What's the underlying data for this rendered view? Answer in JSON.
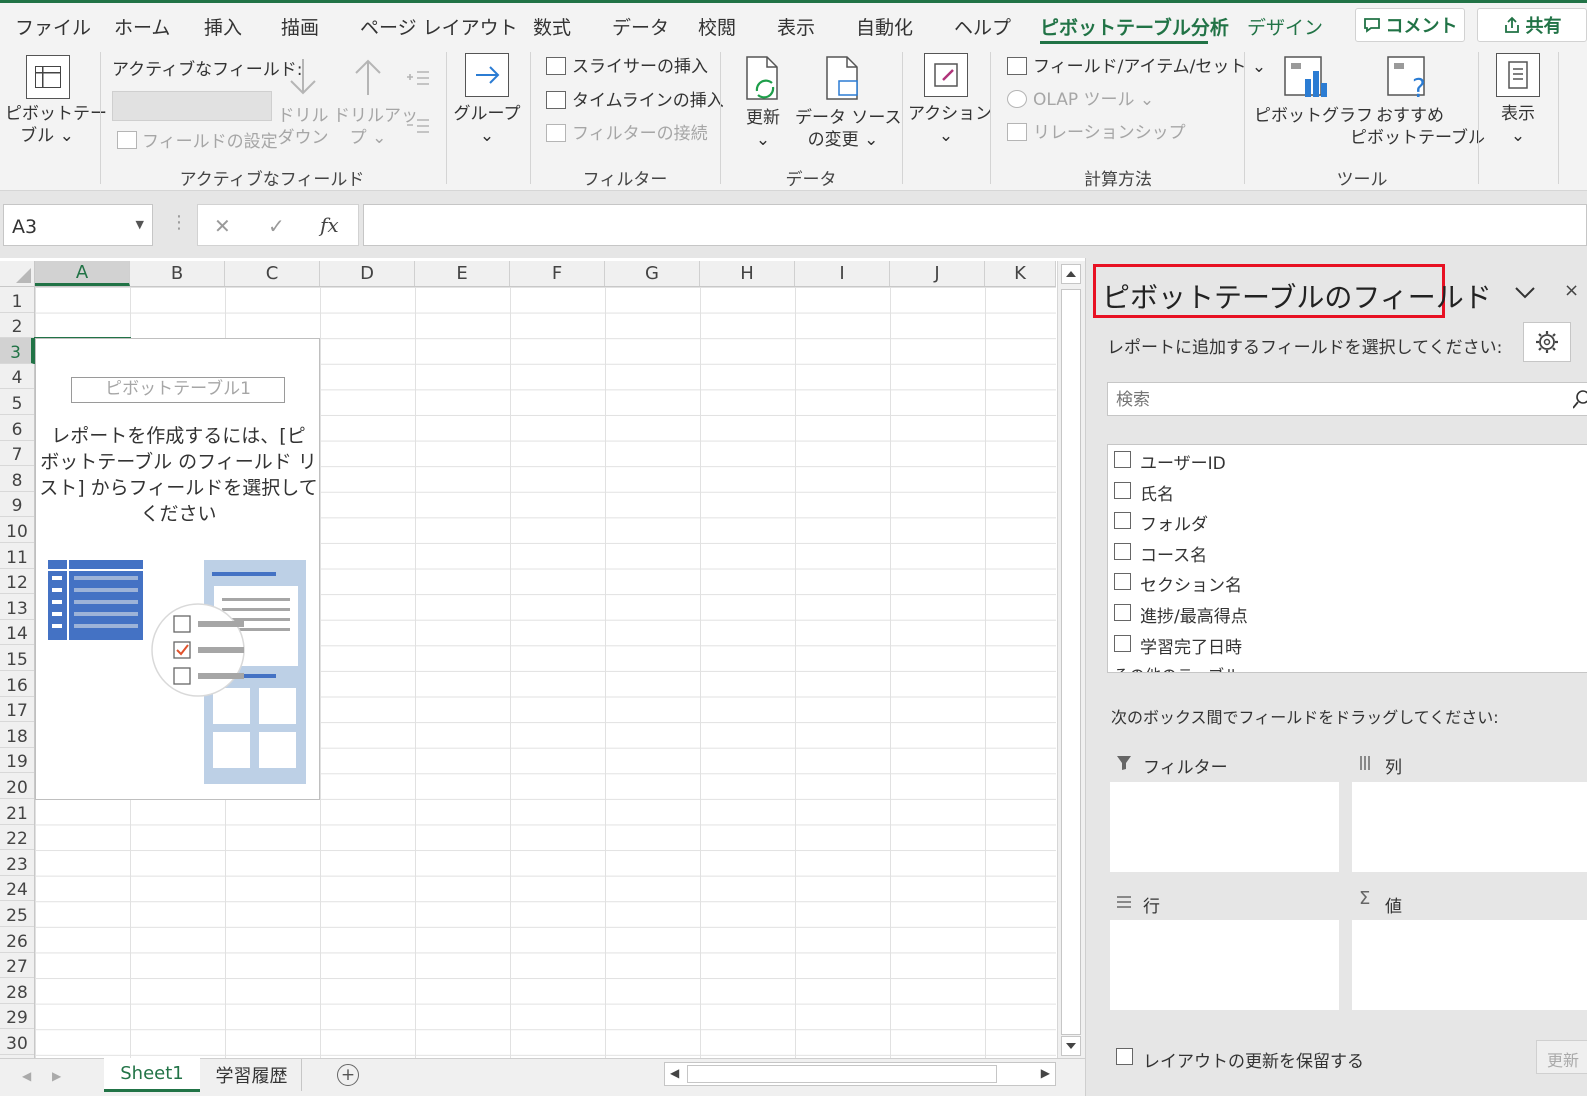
{
  "menu": {
    "tabs": [
      "ファイル",
      "ホーム",
      "挿入",
      "描画",
      "ページ レイアウト",
      "数式",
      "データ",
      "校閲",
      "表示",
      "自動化",
      "ヘルプ",
      "ピボットテーブル分析",
      "デザイン"
    ],
    "active_tab": "ピボットテーブル分析",
    "comment_button": "コメント",
    "share_button": "共有"
  },
  "ribbon": {
    "pivottable": {
      "line1": "ピボットテー",
      "line2": "ブル ⌄"
    },
    "active_field": {
      "label": "アクティブなフィールド:",
      "field_settings": "フィールドの設定",
      "drill_down": {
        "line1": "ドリル",
        "line2": "ダウン"
      },
      "drill_up": {
        "line1": "ドリルアッ",
        "line2": "プ ⌄"
      },
      "group_label": "アクティブなフィールド"
    },
    "group": {
      "line1": "グループ",
      "line2": "⌄"
    },
    "filter": {
      "slicer": "スライサーの挿入",
      "timeline": "タイムラインの挿入",
      "filter_connections": "フィルターの接続",
      "group_label": "フィルター"
    },
    "data": {
      "refresh": {
        "line1": "更新",
        "line2": "⌄"
      },
      "change_source": {
        "line1": "データ ソース",
        "line2": "の変更 ⌄"
      },
      "group_label": "データ"
    },
    "actions": {
      "line1": "アクション",
      "line2": "⌄"
    },
    "calculations": {
      "fields_items": "フィールド/アイテム/セット ⌄",
      "olap": "OLAP ツール ⌄",
      "relationships": "リレーションシップ",
      "group_label": "計算方法"
    },
    "tools": {
      "pivotchart": "ピボットグラフ",
      "recommended": {
        "line1": "おすすめ",
        "line2": "ピボットテーブル"
      },
      "group_label": "ツール"
    },
    "show": {
      "line1": "表示",
      "line2": "⌄"
    }
  },
  "formula_bar": {
    "name_box": "A3",
    "cancel": "✕",
    "enter": "✓",
    "fx": "fx",
    "formula": ""
  },
  "grid": {
    "columns": [
      "A",
      "B",
      "C",
      "D",
      "E",
      "F",
      "G",
      "H",
      "I",
      "J",
      "K"
    ],
    "selected_column": "A",
    "rows": [
      "1",
      "2",
      "3",
      "4",
      "5",
      "6",
      "7",
      "8",
      "9",
      "10",
      "11",
      "12",
      "13",
      "14",
      "15",
      "16",
      "17",
      "18",
      "19",
      "20",
      "21",
      "22",
      "23",
      "24",
      "25",
      "26",
      "27",
      "28",
      "29",
      "30"
    ],
    "selected_row": "3"
  },
  "pivot_placeholder": {
    "name": "ピボットテーブル1",
    "instruction": {
      "line1": "レポートを作成するには、[ピ",
      "line2": "ボットテーブル のフィールド リ",
      "line3": "スト] からフィールドを選択して",
      "line4": "ください"
    }
  },
  "sheets": {
    "tabs": [
      "Sheet1",
      "学習履歴"
    ],
    "active": "Sheet1",
    "add": "+"
  },
  "field_pane": {
    "title": "ピボットテーブルのフィールド",
    "choose_label": "レポートに追加するフィールドを選択してください:",
    "search_placeholder": "検索",
    "fields": [
      "ユーザーID",
      "氏名",
      "フォルダ",
      "コース名",
      "セクション名",
      "進捗/最高得点",
      "学習完了日時"
    ],
    "more_tables": "その他のテーブル...",
    "drag_label": "次のボックス間でフィールドをドラッグしてください:",
    "areas": {
      "filters": "フィルター",
      "columns": "列",
      "rows": "行",
      "values": "値"
    },
    "defer_update": "レイアウトの更新を保留する",
    "update_button": "更新"
  },
  "colors": {
    "accent": "#217346",
    "highlight_border": "#e81123"
  }
}
